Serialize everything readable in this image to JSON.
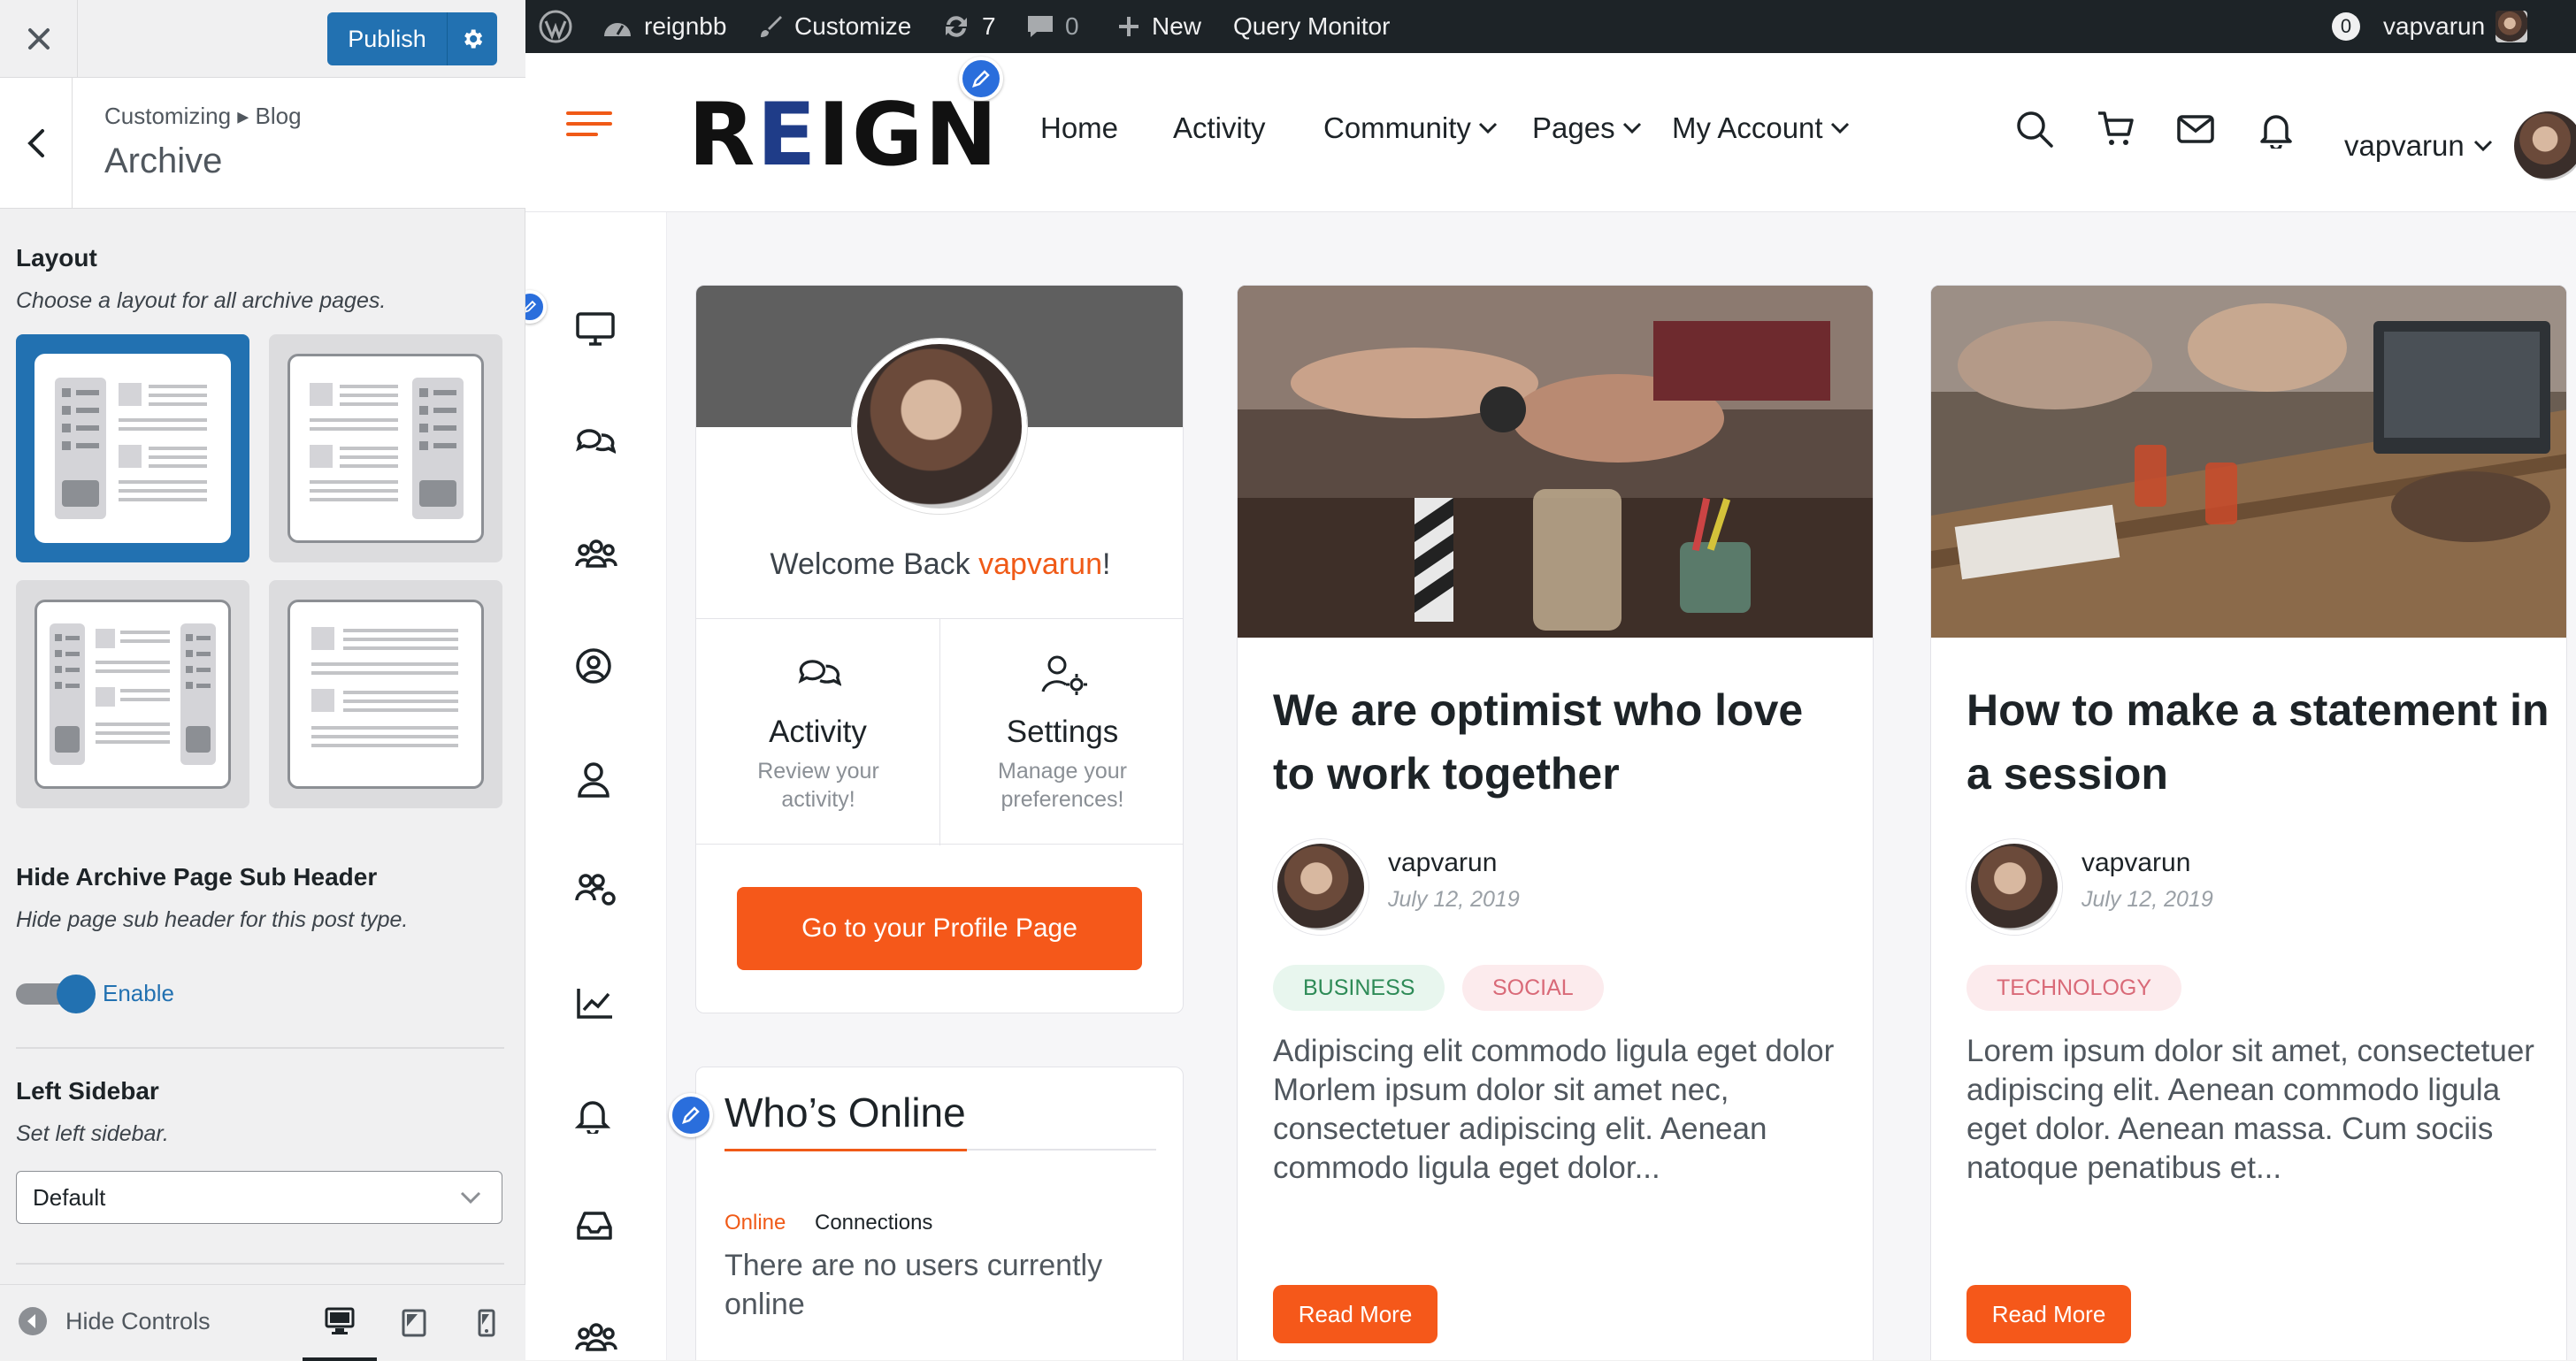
{
  "customizer": {
    "publish_label": "Publish",
    "breadcrumb": "Customizing ▸ Blog",
    "section_title": "Archive",
    "layout": {
      "label": "Layout",
      "description": "Choose a layout for all archive pages.",
      "selected_index": 0
    },
    "sub_header": {
      "label": "Hide Archive Page Sub Header",
      "description": "Hide page sub header for this post type.",
      "toggle_label": "Enable",
      "enabled": true
    },
    "left_sidebar": {
      "label": "Left Sidebar",
      "description": "Set left sidebar.",
      "value": "Default"
    },
    "footer": {
      "hide_controls": "Hide Controls",
      "devices": [
        "desktop",
        "tablet",
        "mobile"
      ],
      "active_device": "desktop"
    }
  },
  "adminbar": {
    "site_name": "reignbb",
    "customize": "Customize",
    "updates": "7",
    "comments": "0",
    "new": "New",
    "query_monitor": "Query Monitor",
    "notifications": "0",
    "user": "vapvarun"
  },
  "header": {
    "logo": "REIGN",
    "nav": [
      {
        "label": "Home",
        "has_dropdown": false
      },
      {
        "label": "Activity",
        "has_dropdown": false
      },
      {
        "label": "Community",
        "has_dropdown": true
      },
      {
        "label": "Pages",
        "has_dropdown": true
      },
      {
        "label": "My Account",
        "has_dropdown": true
      }
    ],
    "user": "vapvarun"
  },
  "profile_widget": {
    "welcome_prefix": "Welcome Back ",
    "username": "vapvarun",
    "welcome_suffix": "!",
    "links": [
      {
        "title": "Activity",
        "desc": "Review your activity!"
      },
      {
        "title": "Settings",
        "desc": "Manage your preferences!"
      }
    ],
    "button": "Go to your Profile Page"
  },
  "online_widget": {
    "title": "Who’s Online",
    "tabs": [
      "Online",
      "Connections"
    ],
    "active_tab": "Online",
    "empty_text": "There are no users currently online"
  },
  "posts": [
    {
      "title": "We are optimist who love to work together",
      "author": "vapvarun",
      "date": "July 12, 2019",
      "tags": [
        "BUSINESS",
        "SOCIAL"
      ],
      "excerpt": "Adipiscing elit commodo ligula eget dolor Morlem ipsum dolor sit amet nec, consectetuer adipiscing elit. Aenean commodo ligula eget dolor...",
      "read_more": "Read More"
    },
    {
      "title": "How to make a statement in a session",
      "author": "vapvarun",
      "date": "July 12, 2019",
      "tags": [
        "TECHNOLOGY"
      ],
      "excerpt": "Lorem ipsum dolor sit amet, consectetuer adipiscing elit. Aenean commodo ligula eget dolor. Aenean massa. Cum sociis natoque penatibus et...",
      "read_more": "Read More"
    }
  ],
  "colors": {
    "wp_blue": "#2271b1",
    "accent_orange": "#f5581a",
    "logo_blue": "#1f3c88",
    "admin_bar": "#1d2327"
  }
}
